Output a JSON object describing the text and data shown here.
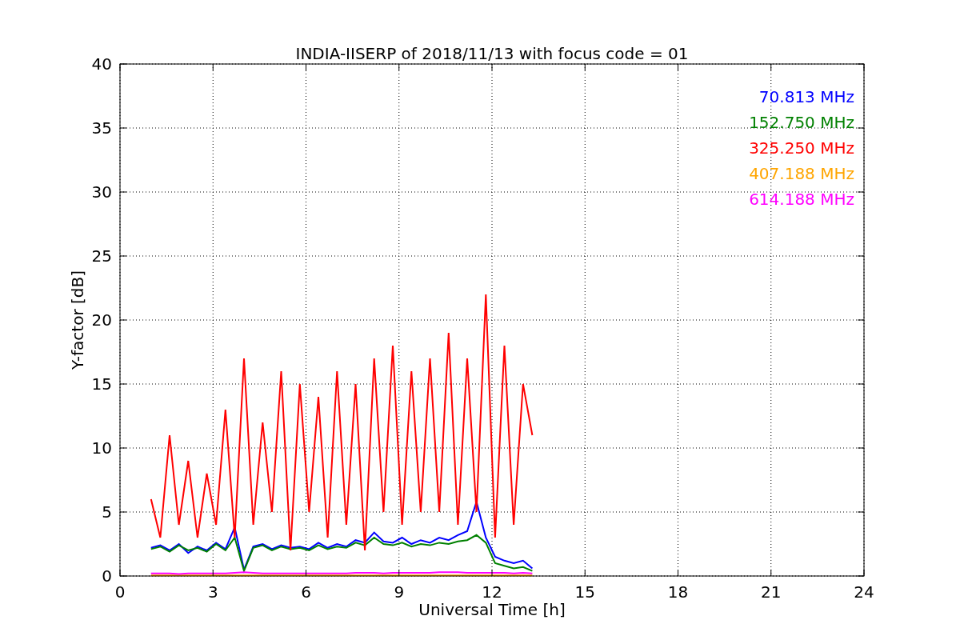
{
  "chart_data": {
    "type": "line",
    "title": "INDIA-IISERP of 2018/11/13 with focus code = 01",
    "xlabel": "Universal Time [h]",
    "ylabel": "Y-factor [dB]",
    "x": [
      1.0,
      1.3,
      1.6,
      1.9,
      2.2,
      2.5,
      2.8,
      3.1,
      3.4,
      3.7,
      4.0,
      4.3,
      4.6,
      4.9,
      5.2,
      5.5,
      5.8,
      6.1,
      6.4,
      6.7,
      7.0,
      7.3,
      7.6,
      7.9,
      8.2,
      8.5,
      8.8,
      9.1,
      9.4,
      9.7,
      10.0,
      10.3,
      10.6,
      10.9,
      11.2,
      11.5,
      11.8,
      12.1,
      12.4,
      12.7,
      13.0,
      13.3
    ],
    "series": [
      {
        "name": "70.813 MHz",
        "color": "#0000ff",
        "values": [
          2.2,
          2.4,
          2.0,
          2.5,
          1.8,
          2.3,
          2.0,
          2.6,
          2.1,
          3.8,
          0.5,
          2.3,
          2.5,
          2.1,
          2.4,
          2.2,
          2.3,
          2.1,
          2.6,
          2.2,
          2.5,
          2.3,
          2.8,
          2.6,
          3.4,
          2.7,
          2.6,
          3.0,
          2.5,
          2.8,
          2.6,
          3.0,
          2.8,
          3.2,
          3.5,
          5.8,
          3.0,
          1.5,
          1.2,
          1.0,
          1.2,
          0.6
        ]
      },
      {
        "name": "152.750 MHz",
        "color": "#008000",
        "values": [
          2.1,
          2.3,
          1.9,
          2.4,
          2.0,
          2.2,
          1.9,
          2.5,
          2.0,
          3.0,
          0.4,
          2.2,
          2.4,
          2.0,
          2.3,
          2.1,
          2.2,
          2.0,
          2.4,
          2.1,
          2.3,
          2.2,
          2.6,
          2.4,
          3.0,
          2.5,
          2.4,
          2.6,
          2.3,
          2.5,
          2.4,
          2.6,
          2.5,
          2.7,
          2.8,
          3.2,
          2.6,
          1.0,
          0.8,
          0.6,
          0.7,
          0.4
        ]
      },
      {
        "name": "325.250 MHz",
        "color": "#ff0000",
        "values": [
          6,
          3,
          11,
          4,
          9,
          3,
          8,
          4,
          13,
          3,
          17,
          4,
          12,
          5,
          16,
          2,
          15,
          5,
          14,
          3,
          16,
          4,
          15,
          2,
          17,
          5,
          18,
          4,
          16,
          5,
          17,
          5,
          19,
          4,
          17,
          5,
          22,
          3,
          18,
          4,
          15,
          11
        ]
      },
      {
        "name": "407.188 MHz",
        "color": "#ffa500",
        "values": [
          0.05,
          0.05,
          0.05,
          0.05,
          0.05,
          0.05,
          0.05,
          0.05,
          0.05,
          0.05,
          0.05,
          0.05,
          0.05,
          0.05,
          0.05,
          0.05,
          0.05,
          0.05,
          0.05,
          0.05,
          0.05,
          0.05,
          0.05,
          0.05,
          0.05,
          0.05,
          0.05,
          0.05,
          0.05,
          0.05,
          0.05,
          0.05,
          0.05,
          0.05,
          0.05,
          0.05,
          0.05,
          0.05,
          0.05,
          0.05,
          0.05,
          0.05
        ]
      },
      {
        "name": "614.188 MHz",
        "color": "#ff00ff",
        "values": [
          0.2,
          0.2,
          0.2,
          0.15,
          0.2,
          0.2,
          0.2,
          0.2,
          0.2,
          0.25,
          0.3,
          0.25,
          0.2,
          0.2,
          0.2,
          0.2,
          0.2,
          0.2,
          0.2,
          0.2,
          0.2,
          0.2,
          0.25,
          0.25,
          0.25,
          0.2,
          0.25,
          0.25,
          0.25,
          0.25,
          0.25,
          0.3,
          0.3,
          0.3,
          0.25,
          0.25,
          0.25,
          0.25,
          0.25,
          0.2,
          0.25,
          0.2
        ]
      }
    ],
    "grid": true,
    "xlim": [
      0,
      24
    ],
    "ylim": [
      0,
      40
    ],
    "xticks": [
      0,
      3,
      6,
      9,
      12,
      15,
      18,
      21,
      24
    ],
    "yticks": [
      0,
      5,
      10,
      15,
      20,
      25,
      30,
      35,
      40
    ]
  }
}
